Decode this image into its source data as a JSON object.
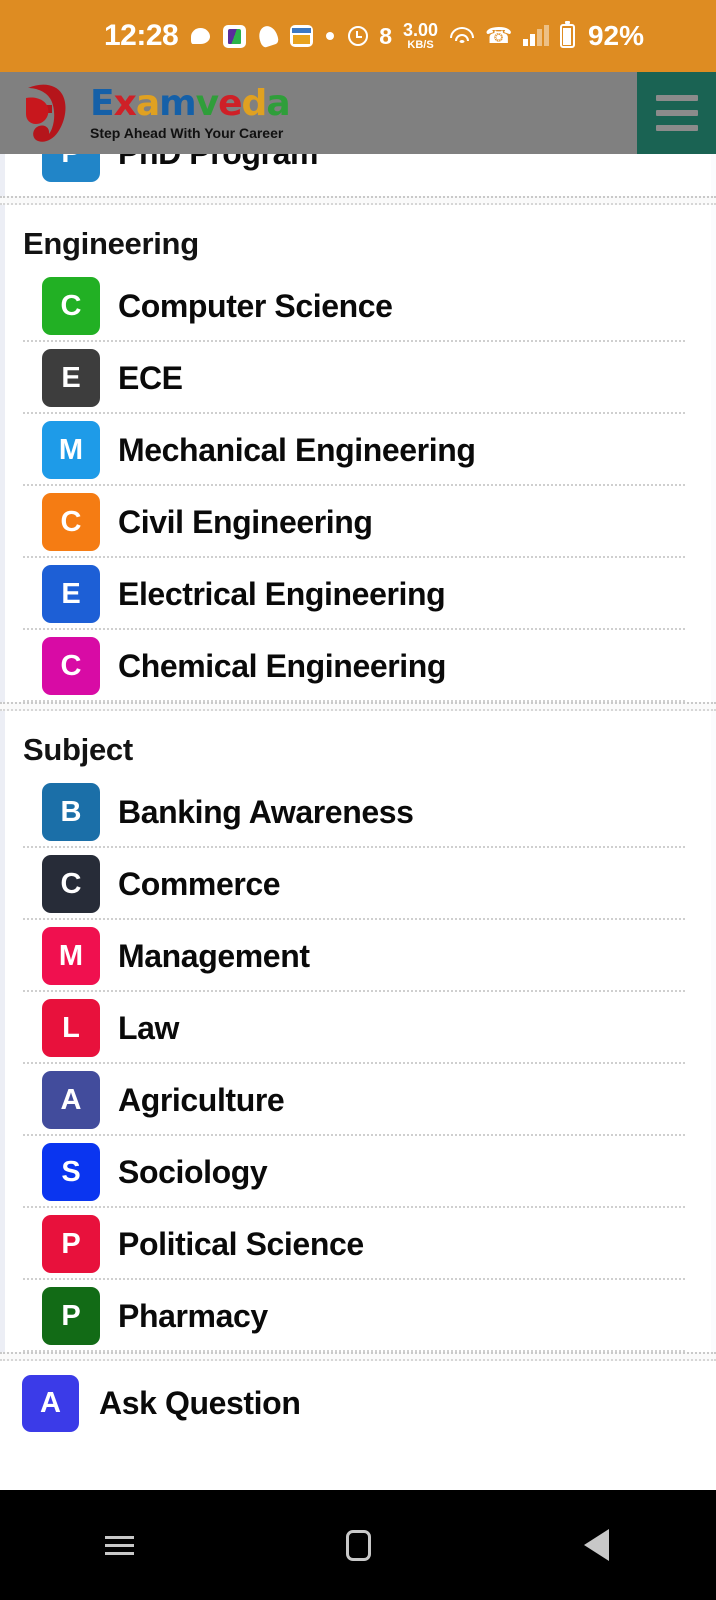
{
  "status_bar": {
    "time": "12:28",
    "network_speed_value": "3.00",
    "network_speed_unit": "KB/S",
    "battery_percent": "92%",
    "bluetooth_glyph": "8",
    "phone_glyph": "☎",
    "icons": [
      "chat-icon",
      "notebook-icon",
      "bell-icon",
      "calendar-icon",
      "dot-icon",
      "alarm-icon",
      "bluetooth-icon",
      "data-speed-icon",
      "wifi-icon",
      "wifi-calling-icon",
      "signal-icon",
      "battery-icon"
    ],
    "background_color": "#de8c22"
  },
  "app_bar": {
    "logo_letters": [
      {
        "ch": "E",
        "color": "#1560a8"
      },
      {
        "ch": "x",
        "color": "#cf2027"
      },
      {
        "ch": "a",
        "color": "#e0a121"
      },
      {
        "ch": "m",
        "color": "#1560a8"
      },
      {
        "ch": "v",
        "color": "#2f9e3a"
      },
      {
        "ch": "e",
        "color": "#cf2027"
      },
      {
        "ch": "d",
        "color": "#e0a121"
      },
      {
        "ch": "a",
        "color": "#2f9e3a"
      }
    ],
    "tagline": "Step Ahead With Your Career",
    "background_color": "#808080",
    "menu_button_color": "#1a6353"
  },
  "cut_row": {
    "letter": "P",
    "label": "PhD Program",
    "color": "#2185c8"
  },
  "sections": [
    {
      "title": "Engineering",
      "items": [
        {
          "letter": "C",
          "label": "Computer Science",
          "color": "#22b024"
        },
        {
          "letter": "E",
          "label": "ECE",
          "color": "#3d3d3d"
        },
        {
          "letter": "M",
          "label": "Mechanical Engineering",
          "color": "#1e9be8"
        },
        {
          "letter": "C",
          "label": "Civil Engineering",
          "color": "#f57c13"
        },
        {
          "letter": "E",
          "label": "Electrical Engineering",
          "color": "#1d5fd6"
        },
        {
          "letter": "C",
          "label": "Chemical Engineering",
          "color": "#d80ba5"
        }
      ]
    },
    {
      "title": "Subject",
      "items": [
        {
          "letter": "B",
          "label": "Banking Awareness",
          "color": "#1b6fa8"
        },
        {
          "letter": "C",
          "label": "Commerce",
          "color": "#272c38"
        },
        {
          "letter": "M",
          "label": "Management",
          "color": "#f0104f"
        },
        {
          "letter": "L",
          "label": "Law",
          "color": "#e8113c"
        },
        {
          "letter": "A",
          "label": "Agriculture",
          "color": "#424c9c"
        },
        {
          "letter": "S",
          "label": "Sociology",
          "color": "#0a35f0"
        },
        {
          "letter": "P",
          "label": "Political Science",
          "color": "#e8113c"
        },
        {
          "letter": "P",
          "label": "Pharmacy",
          "color": "#126b16"
        }
      ]
    }
  ],
  "ask_question": {
    "letter": "A",
    "label": "Ask Question",
    "color": "#3b3be8"
  },
  "nav_bar": {
    "recent_label": "recent-apps",
    "home_label": "home",
    "back_label": "back",
    "background_color": "#000000"
  }
}
